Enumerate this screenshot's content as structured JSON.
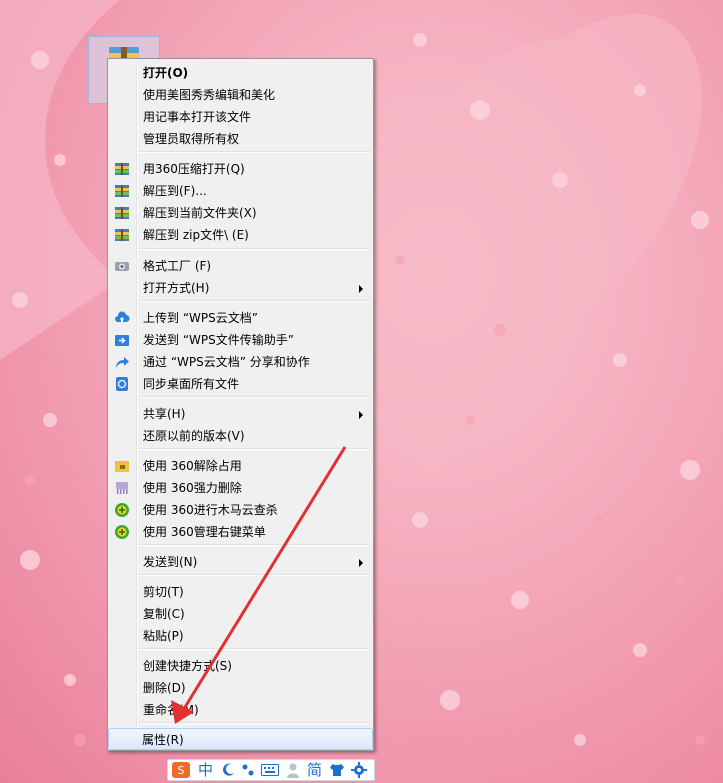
{
  "menu": {
    "items": [
      {
        "label": "打开(O)",
        "icon": "",
        "bold": true,
        "submenu": false
      },
      {
        "label": "使用美图秀秀编辑和美化",
        "icon": "",
        "submenu": false
      },
      {
        "label": "用记事本打开该文件",
        "icon": "",
        "submenu": false
      },
      {
        "label": "管理员取得所有权",
        "icon": "",
        "submenu": false
      },
      {
        "label": "用360压缩打开(Q)",
        "icon": "archive-icon",
        "submenu": false
      },
      {
        "label": "解压到(F)...",
        "icon": "archive-icon",
        "submenu": false
      },
      {
        "label": "解压到当前文件夹(X)",
        "icon": "archive-icon",
        "submenu": false
      },
      {
        "label": "解压到 zip文件\\ (E)",
        "icon": "archive-icon",
        "submenu": false
      },
      {
        "label": "格式工厂 (F)",
        "icon": "format-factory-icon",
        "submenu": false
      },
      {
        "label": "打开方式(H)",
        "icon": "",
        "submenu": true
      },
      {
        "label": "上传到 “WPS云文档”",
        "icon": "cloud-upload-icon",
        "submenu": false
      },
      {
        "label": "发送到 “WPS文件传输助手”",
        "icon": "send-folder-icon",
        "submenu": false
      },
      {
        "label": "通过 “WPS云文档” 分享和协作",
        "icon": "share-arrow-icon",
        "submenu": false
      },
      {
        "label": "同步桌面所有文件",
        "icon": "sync-icon",
        "submenu": false
      },
      {
        "label": "共享(H)",
        "icon": "",
        "submenu": true
      },
      {
        "label": "还原以前的版本(V)",
        "icon": "",
        "submenu": false
      },
      {
        "label": "使用 360解除占用",
        "icon": "unlock-folder-icon",
        "submenu": false
      },
      {
        "label": "使用 360强力删除",
        "icon": "shred-icon",
        "submenu": false
      },
      {
        "label": "使用 360进行木马云查杀",
        "icon": "360-shield-icon",
        "submenu": false
      },
      {
        "label": "使用 360管理右键菜单",
        "icon": "360-shield-icon",
        "submenu": false
      },
      {
        "label": "发送到(N)",
        "icon": "",
        "submenu": true
      },
      {
        "label": "剪切(T)",
        "icon": "",
        "submenu": false
      },
      {
        "label": "复制(C)",
        "icon": "",
        "submenu": false
      },
      {
        "label": "粘贴(P)",
        "icon": "",
        "submenu": false
      },
      {
        "label": "创建快捷方式(S)",
        "icon": "",
        "submenu": false
      },
      {
        "label": "删除(D)",
        "icon": "",
        "submenu": false
      },
      {
        "label": "重命名(M)",
        "icon": "",
        "submenu": false
      },
      {
        "label": "属性(R)",
        "icon": "",
        "submenu": false,
        "selected": true
      }
    ]
  },
  "ime": {
    "logo": "sogou-logo",
    "mode": "中",
    "width": "简"
  },
  "colors": {
    "highlight_border": "#aecff7",
    "annotation_arrow": "#e03030"
  }
}
